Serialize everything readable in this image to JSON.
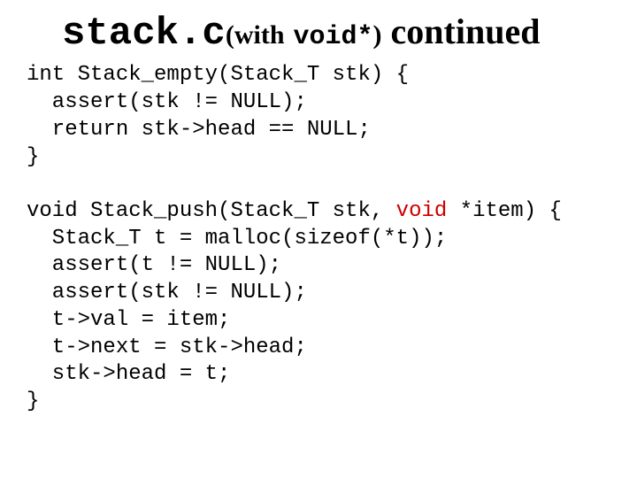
{
  "title": {
    "mono1": "stack.c",
    "paren_open": "(with",
    "mono2": "void*",
    "paren_close": ")",
    "continued": "continued"
  },
  "code": {
    "l01": "int Stack_empty(Stack_T stk) {",
    "l02": "  assert(stk != NULL);",
    "l03": "  return stk->head == NULL;",
    "l04": "}",
    "l05": "",
    "l06a": "void Stack_push(Stack_T stk, ",
    "l06b": "void",
    "l06c": " *item) {",
    "l07": "  Stack_T t = malloc(sizeof(*t));",
    "l08": "  assert(t != NULL);",
    "l09": "  assert(stk != NULL);",
    "l10": "  t->val = item;",
    "l11": "  t->next = stk->head;",
    "l12": "  stk->head = t;",
    "l13": "}"
  }
}
